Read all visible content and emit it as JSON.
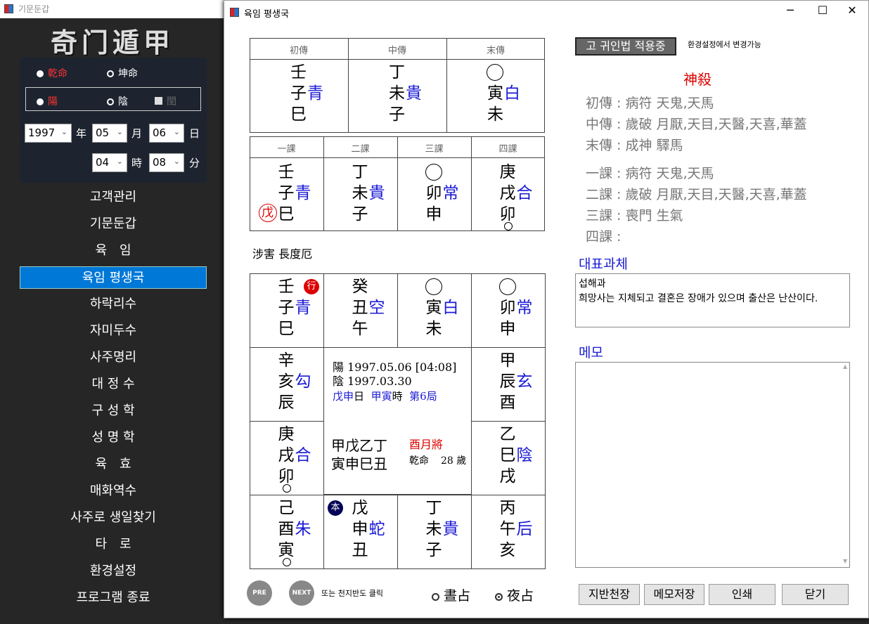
{
  "bg": {
    "title": "기문둔갑",
    "logo": "奇门遁甲",
    "gender": {
      "male": "乾命",
      "female": "坤命"
    },
    "yin_yang": {
      "yang": "陽",
      "yin": "陰",
      "leap": "閏"
    },
    "date": {
      "year": "1997",
      "month": "05",
      "day": "06",
      "hour": "04",
      "minute": "08",
      "y_label": "年",
      "m_label": "月",
      "d_label": "日",
      "h_label": "時",
      "min_label": "分"
    },
    "menu": [
      "고객관리",
      "기문둔갑",
      "육　임",
      "육임 평생국",
      "하락리수",
      "자미두수",
      "사주명리",
      "대 정 수",
      "구 성 학",
      "성 명 학",
      "육　효",
      "매화역수",
      "사주로 생일찾기",
      "타　로",
      "환경설정",
      "프로그램 종료"
    ]
  },
  "win": {
    "title": "육임 평생국",
    "min": "─",
    "max": "☐",
    "close": "✕"
  },
  "sanchuan": {
    "headers": [
      "初傳",
      "中傳",
      "末傳"
    ],
    "cols": [
      {
        "l1": "壬",
        "l2a": "子",
        "l2b": "青",
        "l3": "巳"
      },
      {
        "l1": "丁",
        "l2a": "未",
        "l2b": "貴",
        "l3": "子"
      },
      {
        "l1": "",
        "l2a": "寅",
        "l2b": "白",
        "l3": "未"
      }
    ]
  },
  "sike": {
    "headers": [
      "一課",
      "二課",
      "三課",
      "四課"
    ],
    "cols": [
      {
        "l1": "壬",
        "l2a": "子",
        "l2b": "青",
        "l3": "巳",
        "mark": "戊"
      },
      {
        "l1": "丁",
        "l2a": "未",
        "l2b": "貴",
        "l3": "子"
      },
      {
        "l1": "",
        "l2a": "卯",
        "l2b": "常",
        "l3": "申"
      },
      {
        "l1": "庚",
        "l2a": "戌",
        "l2b": "合",
        "l3": "卯"
      }
    ]
  },
  "pattern": "涉害 長度厄",
  "board": {
    "c1": {
      "l1": "壬",
      "l2a": "子",
      "l2b": "青",
      "l3": "巳",
      "badge": "行"
    },
    "c2": {
      "l1": "癸",
      "l2a": "丑",
      "l2b": "空",
      "l3": "午"
    },
    "c3": {
      "l1": "",
      "l2a": "寅",
      "l2b": "白",
      "l3": "未"
    },
    "c4": {
      "l1": "",
      "l2a": "卯",
      "l2b": "常",
      "l3": "申"
    },
    "c5": {
      "l1": "辛",
      "l2a": "亥",
      "l2b": "勾",
      "l3": "辰"
    },
    "c6": {
      "l1": "甲",
      "l2a": "辰",
      "l2b": "玄",
      "l3": "酉"
    },
    "c7": {
      "l1": "庚",
      "l2a": "戌",
      "l2b": "合",
      "l3": "卯"
    },
    "c8": {
      "l1": "乙",
      "l2a": "巳",
      "l2b": "陰",
      "l3": "戌"
    },
    "c9": {
      "l1": "己",
      "l2a": "酉",
      "l2b": "朱",
      "l3": "寅"
    },
    "c10": {
      "l1": "戊",
      "l2a": "申",
      "l2b": "蛇",
      "l3": "丑",
      "badge": "本"
    },
    "c11": {
      "l1": "丁",
      "l2a": "未",
      "l2b": "貴",
      "l3": "子"
    },
    "c12": {
      "l1": "丙",
      "l2a": "午",
      "l2b": "后",
      "l3": "亥"
    }
  },
  "center": {
    "line1": "陽 1997.05.06 [04:08]",
    "line2": "陰 1997.03.30",
    "day": "戊申",
    "day_s": "日",
    "hour": "甲寅",
    "hour_s": "時",
    "ju": "第6局",
    "stems": "甲戊乙丁",
    "branches": "寅申巳丑",
    "month_gen": "酉月將",
    "gender": "乾命",
    "age": "28 歲"
  },
  "nav": {
    "pre": "PRE",
    "next": "NEXT",
    "hint": "또는 천지반도 클릭",
    "day": "晝占",
    "night": "夜占"
  },
  "right": {
    "method_btn": "고 귀인법 적용중",
    "method_hint": "환경설정에서 변경가능",
    "shensha_title": "神殺",
    "chuan_lines": [
      "初傳 : 病符 天鬼,天馬",
      "中傳 : 歲破 月厭,天目,天醫,天喜,華蓋",
      "末傳 :  成神 驛馬"
    ],
    "ke_lines": [
      "一課 : 病符 天鬼,天馬",
      "二課 : 歲破 月厭,天目,天醫,天喜,華蓋",
      "三課 : 喪門 生氣",
      "四課 :"
    ],
    "task_title": "대표과체",
    "task_text1": "섭해과",
    "task_text2": "희망사는 지체되고 결혼은 장애가 있으며 출산은 난산이다.",
    "memo_title": "메모",
    "memo": "",
    "buttons": [
      "지반천장",
      "메모저장",
      "인쇄",
      "닫기"
    ]
  },
  "colors": {
    "blue": "#1a1ad6",
    "red": "#dd0000",
    "selected": "#0078d7"
  }
}
